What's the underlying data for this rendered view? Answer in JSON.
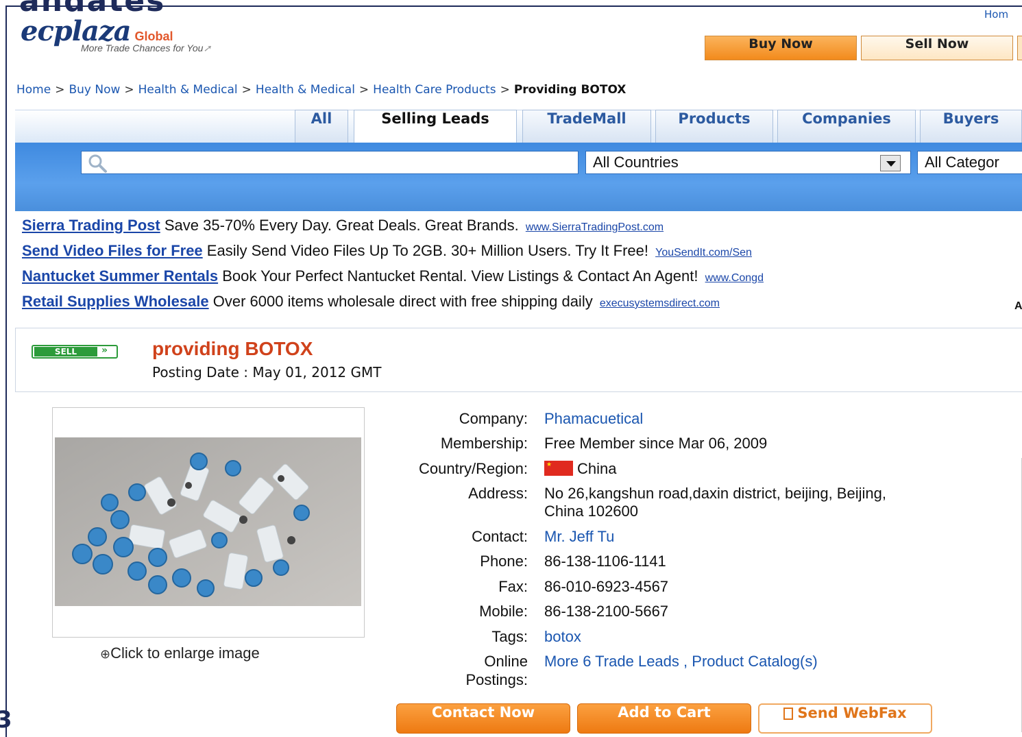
{
  "frame": {
    "top_text": "andates",
    "left_deco": "3"
  },
  "header": {
    "logo": "ecplaza",
    "logo_suffix": "Global",
    "tagline": "More Trade Chances for You",
    "home_link": "Hom",
    "buy_now": "Buy Now",
    "sell_now": "Sell Now"
  },
  "breadcrumb": [
    "Home",
    "Buy Now",
    "Health & Medical",
    "Health & Medical",
    "Health Care Products"
  ],
  "breadcrumb_current": "Providing BOTOX",
  "breadcrumb_sep": ">",
  "tabs": [
    "All",
    "Selling Leads",
    "TradeMall",
    "Products",
    "Companies",
    "Buyers"
  ],
  "search": {
    "query": "",
    "country": "All Countries",
    "category": "All Categor"
  },
  "ads": [
    {
      "title": "Sierra Trading Post",
      "text": "Save 35-70% Every Day. Great Deals. Great Brands.",
      "url": "www.SierraTradingPost.com"
    },
    {
      "title": "Send Video Files for Free",
      "text": "Easily Send Video Files Up To 2GB. 30+ Million Users. Try It Free!",
      "url": "YouSendIt.com/Sen"
    },
    {
      "title": "Nantucket Summer Rentals",
      "text": "Book Your Perfect Nantucket Rental. View Listings & Contact An Agent!",
      "url": "www.Congd"
    },
    {
      "title": "Retail Supplies Wholesale",
      "text": "Over 6000 items wholesale direct with free shipping daily",
      "url": "execusystemsdirect.com"
    }
  ],
  "ad_badge": "A",
  "listing": {
    "badge": "SELL",
    "badge_chevron": "»",
    "title": "providing BOTOX",
    "posting_date": "Posting Date : May 01, 2012 GMT",
    "enlarge": "Click to enlarge image"
  },
  "details": {
    "company_label": "Company:",
    "company": "Phamacuetical",
    "membership_label": "Membership:",
    "membership": "Free Member since Mar 06, 2009",
    "country_label": "Country/Region:",
    "country": "China",
    "address_label": "Address:",
    "address_1": "No 26,kangshun road,daxin district, beijing, Beijing,",
    "address_2": "China 102600",
    "contact_label": "Contact:",
    "contact": "Mr. Jeff Tu",
    "phone_label": "Phone:",
    "phone": "86-138-1106-1141",
    "fax_label": "Fax:",
    "fax": "86-010-6923-4567",
    "mobile_label": "Mobile:",
    "mobile": "86-138-2100-5667",
    "tags_label": "Tags:",
    "tags": "botox",
    "online_label_1": "Online",
    "online_label_2": "Postings:",
    "trade_leads": "More 6 Trade Leads",
    "comma": ",",
    "catalog": "Product Catalog(s)"
  },
  "actions": {
    "contact": "Contact Now",
    "cart": "Add to Cart",
    "fax": "Send WebFax"
  },
  "colors": {
    "brand_blue": "#1b3a78",
    "link": "#1a56b0",
    "orange": "#ee7a12",
    "title_red": "#d0421b",
    "sell_green": "#2c9b3a"
  }
}
